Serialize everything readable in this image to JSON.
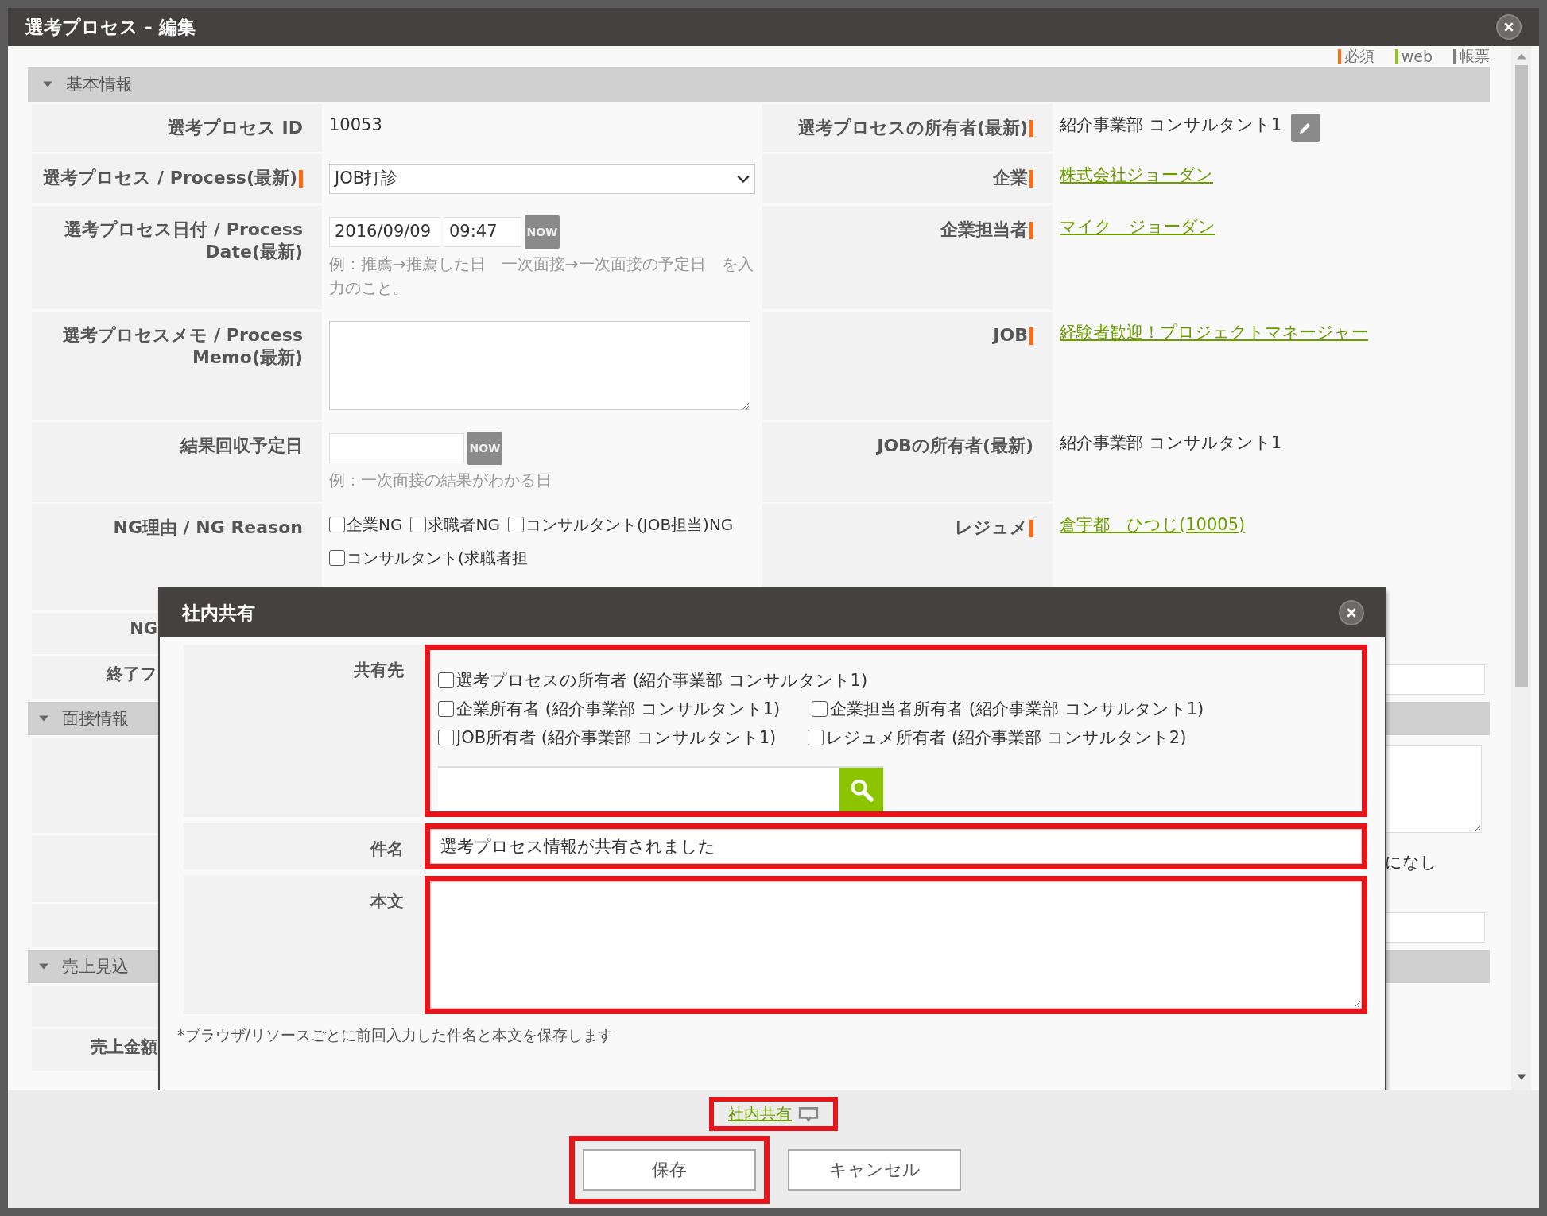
{
  "window": {
    "title": "選考プロセス - 編集"
  },
  "legend": [
    {
      "label": "必須",
      "color": "#ff6a13"
    },
    {
      "label": "web",
      "color": "#8fc31f"
    },
    {
      "label": "帳票",
      "color": "#7f7f7f"
    }
  ],
  "basic_section": {
    "title": "基本情報",
    "expanded": true
  },
  "left_fields": [
    {
      "kind": "text",
      "label": "選考プロセス ID",
      "required": false,
      "value": "10053"
    },
    {
      "kind": "select",
      "label": "選考プロセス / Process(最新)",
      "required": true,
      "value": "JOB打診"
    },
    {
      "kind": "datetime",
      "label": "選考プロセス日付 / Process Date(最新)",
      "required": false,
      "date": "2016/09/09",
      "time": "09:47",
      "button": "NOW",
      "hint": "例：推薦→推薦した日　一次面接→一次面接の予定日　を入力のこと。"
    },
    {
      "kind": "textarea",
      "label": "選考プロセスメモ / Process Memo(最新)",
      "required": false
    },
    {
      "kind": "date",
      "label": "結果回収予定日",
      "required": false,
      "button": "NOW",
      "hint": "例：一次面接の結果がわかる日"
    },
    {
      "kind": "checkboxes",
      "label": "NG理由 / NG Reason",
      "required": false,
      "options": [
        {
          "label": "企業NG",
          "checked": false
        },
        {
          "label": "求職者NG",
          "checked": false
        },
        {
          "label": "コンサルタント(JOB担当)NG",
          "checked": false
        },
        {
          "label": "コンサルタント(求職者担",
          "checked": false
        }
      ]
    }
  ],
  "right_fields": [
    {
      "kind": "text",
      "label": "選考プロセスの所有者(最新)",
      "required": true,
      "value": "紹介事業部 コンサルタント1",
      "editable": true
    },
    {
      "kind": "link",
      "label": "企業",
      "required": true,
      "value": "株式会社ジョーダン"
    },
    {
      "kind": "link",
      "label": "企業担当者",
      "required": true,
      "value": "マイク　ジョーダン"
    },
    {
      "kind": "link",
      "label": "JOB",
      "required": true,
      "value": "経験者歓迎！プロジェクトマネージャー"
    },
    {
      "kind": "text",
      "label": "JOBの所有者(最新)",
      "required": false,
      "value": "紹介事業部 コンサルタント1",
      "editable": false
    },
    {
      "kind": "link",
      "label": "レジュメ",
      "required": true,
      "value": "倉宇都　ひつじ(10005)"
    }
  ],
  "lower_rows": [
    {
      "kind": "blank",
      "label": "NG"
    },
    {
      "kind": "input",
      "label": "終了フ"
    },
    {
      "kind": "section",
      "title": "面接情報",
      "expanded": true
    },
    {
      "kind": "textarea"
    },
    {
      "kind": "text",
      "text": "になし"
    },
    {
      "kind": "input"
    },
    {
      "kind": "section",
      "title": "売上見込",
      "expanded": true
    },
    {
      "kind": "blank"
    },
    {
      "kind": "blank",
      "label": "売上金額"
    }
  ],
  "share_dialog": {
    "title": "社内共有",
    "fields": [
      {
        "kind": "recipients",
        "label": "共有先",
        "highlighted": true,
        "rows": [
          {
            "options": [
              {
                "label": "選考プロセスの所有者 (紹介事業部 コンサルタント1)",
                "checked": false
              }
            ]
          },
          {
            "options": [
              {
                "label": "企業所有者 (紹介事業部 コンサルタント1)",
                "checked": false
              },
              {
                "label": "企業担当者所有者 (紹介事業部 コンサルタント1)",
                "checked": false
              }
            ]
          },
          {
            "options": [
              {
                "label": "JOB所有者 (紹介事業部 コンサルタント1)",
                "checked": false
              },
              {
                "label": "レジュメ所有者 (紹介事業部 コンサルタント2)",
                "checked": false
              }
            ]
          }
        ]
      },
      {
        "kind": "input",
        "label": "件名",
        "highlighted": true,
        "value": "選考プロセス情報が共有されました"
      },
      {
        "kind": "textarea",
        "label": "本文",
        "highlighted": true
      }
    ],
    "note": "*ブラウザ/リソースごとに前回入力した件名と本文を保存します"
  },
  "footer": {
    "share_link": {
      "label": "社内共有",
      "highlighted": true
    },
    "buttons": [
      {
        "label": "保存",
        "highlighted": true
      },
      {
        "label": "キャンセル",
        "highlighted": false
      }
    ]
  }
}
